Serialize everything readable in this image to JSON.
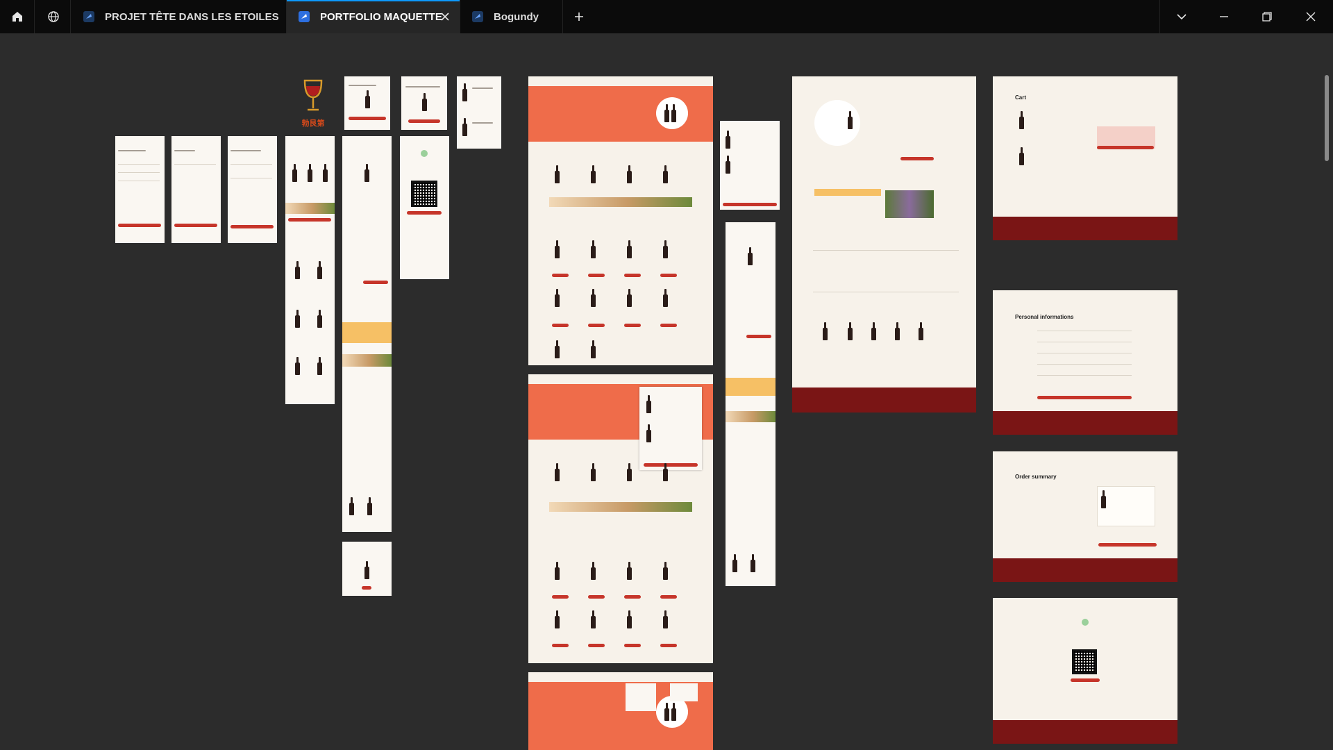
{
  "titlebar": {
    "home_icon": "home-icon",
    "community_icon": "globe-icon",
    "tabs": [
      {
        "label": "PROJET TÊTE DANS LES ETOILES",
        "icon": "figma-file-icon",
        "active": false
      },
      {
        "label": "PORTFOLIO MAQUETTE",
        "icon": "figma-file-icon",
        "active": true
      },
      {
        "label": "Bogundy",
        "icon": "figma-file-icon",
        "active": false
      }
    ],
    "new_tab_icon": "plus-icon",
    "window_controls": [
      "chevron-down-icon",
      "minimize-icon",
      "restore-icon",
      "close-icon"
    ]
  },
  "canvas": {
    "brand_logo_text": "勃艮第",
    "frame_labels": {
      "cart_title": "Cart",
      "personal_info_title": "Personal informations",
      "order_summary_title": "Order summary"
    },
    "colors": {
      "accent": "#ef6c4a",
      "brand_red": "#c6352a",
      "footer": "#7a1515",
      "paper": "#f7f2ea",
      "canvas_bg": "#2c2c2c",
      "titlebar_bg": "#0b0b0b",
      "active_tab_indicator": "#0d99ff"
    }
  }
}
